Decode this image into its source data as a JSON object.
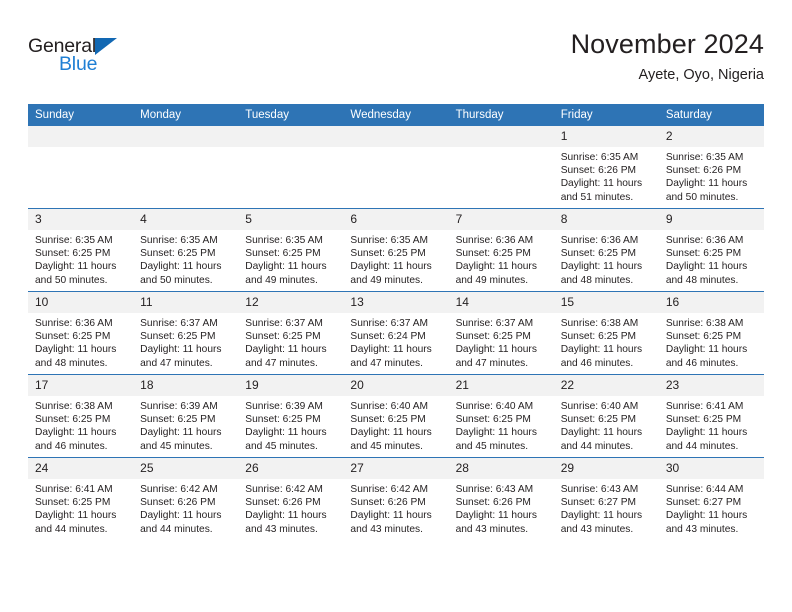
{
  "brand": {
    "name_part1": "General",
    "name_part2": "Blue",
    "logo_icon": "triangle-logo-icon",
    "colors": {
      "text": "#231f20",
      "blue": "#1f7fd4",
      "triangle": "#1268b3"
    }
  },
  "header": {
    "title": "November 2024",
    "subtitle": "Ayete, Oyo, Nigeria"
  },
  "theme": {
    "header_row_bg": "#2e74b5",
    "header_row_text": "#ffffff",
    "daynum_bg": "#f2f2f2",
    "cell_text": "#231f20",
    "row_divider": "#2e74b5"
  },
  "weekdays": [
    {
      "label": "Sunday"
    },
    {
      "label": "Monday"
    },
    {
      "label": "Tuesday"
    },
    {
      "label": "Wednesday"
    },
    {
      "label": "Thursday"
    },
    {
      "label": "Friday"
    },
    {
      "label": "Saturday"
    }
  ],
  "weeks": [
    [
      {
        "day": "",
        "empty": true,
        "sunrise": "",
        "sunset": "",
        "daylight": ""
      },
      {
        "day": "",
        "empty": true,
        "sunrise": "",
        "sunset": "",
        "daylight": ""
      },
      {
        "day": "",
        "empty": true,
        "sunrise": "",
        "sunset": "",
        "daylight": ""
      },
      {
        "day": "",
        "empty": true,
        "sunrise": "",
        "sunset": "",
        "daylight": ""
      },
      {
        "day": "",
        "empty": true,
        "sunrise": "",
        "sunset": "",
        "daylight": ""
      },
      {
        "day": "1",
        "empty": false,
        "sunrise": "Sunrise: 6:35 AM",
        "sunset": "Sunset: 6:26 PM",
        "daylight": "Daylight: 11 hours and 51 minutes."
      },
      {
        "day": "2",
        "empty": false,
        "sunrise": "Sunrise: 6:35 AM",
        "sunset": "Sunset: 6:26 PM",
        "daylight": "Daylight: 11 hours and 50 minutes."
      }
    ],
    [
      {
        "day": "3",
        "empty": false,
        "sunrise": "Sunrise: 6:35 AM",
        "sunset": "Sunset: 6:25 PM",
        "daylight": "Daylight: 11 hours and 50 minutes."
      },
      {
        "day": "4",
        "empty": false,
        "sunrise": "Sunrise: 6:35 AM",
        "sunset": "Sunset: 6:25 PM",
        "daylight": "Daylight: 11 hours and 50 minutes."
      },
      {
        "day": "5",
        "empty": false,
        "sunrise": "Sunrise: 6:35 AM",
        "sunset": "Sunset: 6:25 PM",
        "daylight": "Daylight: 11 hours and 49 minutes."
      },
      {
        "day": "6",
        "empty": false,
        "sunrise": "Sunrise: 6:35 AM",
        "sunset": "Sunset: 6:25 PM",
        "daylight": "Daylight: 11 hours and 49 minutes."
      },
      {
        "day": "7",
        "empty": false,
        "sunrise": "Sunrise: 6:36 AM",
        "sunset": "Sunset: 6:25 PM",
        "daylight": "Daylight: 11 hours and 49 minutes."
      },
      {
        "day": "8",
        "empty": false,
        "sunrise": "Sunrise: 6:36 AM",
        "sunset": "Sunset: 6:25 PM",
        "daylight": "Daylight: 11 hours and 48 minutes."
      },
      {
        "day": "9",
        "empty": false,
        "sunrise": "Sunrise: 6:36 AM",
        "sunset": "Sunset: 6:25 PM",
        "daylight": "Daylight: 11 hours and 48 minutes."
      }
    ],
    [
      {
        "day": "10",
        "empty": false,
        "sunrise": "Sunrise: 6:36 AM",
        "sunset": "Sunset: 6:25 PM",
        "daylight": "Daylight: 11 hours and 48 minutes."
      },
      {
        "day": "11",
        "empty": false,
        "sunrise": "Sunrise: 6:37 AM",
        "sunset": "Sunset: 6:25 PM",
        "daylight": "Daylight: 11 hours and 47 minutes."
      },
      {
        "day": "12",
        "empty": false,
        "sunrise": "Sunrise: 6:37 AM",
        "sunset": "Sunset: 6:25 PM",
        "daylight": "Daylight: 11 hours and 47 minutes."
      },
      {
        "day": "13",
        "empty": false,
        "sunrise": "Sunrise: 6:37 AM",
        "sunset": "Sunset: 6:24 PM",
        "daylight": "Daylight: 11 hours and 47 minutes."
      },
      {
        "day": "14",
        "empty": false,
        "sunrise": "Sunrise: 6:37 AM",
        "sunset": "Sunset: 6:25 PM",
        "daylight": "Daylight: 11 hours and 47 minutes."
      },
      {
        "day": "15",
        "empty": false,
        "sunrise": "Sunrise: 6:38 AM",
        "sunset": "Sunset: 6:25 PM",
        "daylight": "Daylight: 11 hours and 46 minutes."
      },
      {
        "day": "16",
        "empty": false,
        "sunrise": "Sunrise: 6:38 AM",
        "sunset": "Sunset: 6:25 PM",
        "daylight": "Daylight: 11 hours and 46 minutes."
      }
    ],
    [
      {
        "day": "17",
        "empty": false,
        "sunrise": "Sunrise: 6:38 AM",
        "sunset": "Sunset: 6:25 PM",
        "daylight": "Daylight: 11 hours and 46 minutes."
      },
      {
        "day": "18",
        "empty": false,
        "sunrise": "Sunrise: 6:39 AM",
        "sunset": "Sunset: 6:25 PM",
        "daylight": "Daylight: 11 hours and 45 minutes."
      },
      {
        "day": "19",
        "empty": false,
        "sunrise": "Sunrise: 6:39 AM",
        "sunset": "Sunset: 6:25 PM",
        "daylight": "Daylight: 11 hours and 45 minutes."
      },
      {
        "day": "20",
        "empty": false,
        "sunrise": "Sunrise: 6:40 AM",
        "sunset": "Sunset: 6:25 PM",
        "daylight": "Daylight: 11 hours and 45 minutes."
      },
      {
        "day": "21",
        "empty": false,
        "sunrise": "Sunrise: 6:40 AM",
        "sunset": "Sunset: 6:25 PM",
        "daylight": "Daylight: 11 hours and 45 minutes."
      },
      {
        "day": "22",
        "empty": false,
        "sunrise": "Sunrise: 6:40 AM",
        "sunset": "Sunset: 6:25 PM",
        "daylight": "Daylight: 11 hours and 44 minutes."
      },
      {
        "day": "23",
        "empty": false,
        "sunrise": "Sunrise: 6:41 AM",
        "sunset": "Sunset: 6:25 PM",
        "daylight": "Daylight: 11 hours and 44 minutes."
      }
    ],
    [
      {
        "day": "24",
        "empty": false,
        "sunrise": "Sunrise: 6:41 AM",
        "sunset": "Sunset: 6:25 PM",
        "daylight": "Daylight: 11 hours and 44 minutes."
      },
      {
        "day": "25",
        "empty": false,
        "sunrise": "Sunrise: 6:42 AM",
        "sunset": "Sunset: 6:26 PM",
        "daylight": "Daylight: 11 hours and 44 minutes."
      },
      {
        "day": "26",
        "empty": false,
        "sunrise": "Sunrise: 6:42 AM",
        "sunset": "Sunset: 6:26 PM",
        "daylight": "Daylight: 11 hours and 43 minutes."
      },
      {
        "day": "27",
        "empty": false,
        "sunrise": "Sunrise: 6:42 AM",
        "sunset": "Sunset: 6:26 PM",
        "daylight": "Daylight: 11 hours and 43 minutes."
      },
      {
        "day": "28",
        "empty": false,
        "sunrise": "Sunrise: 6:43 AM",
        "sunset": "Sunset: 6:26 PM",
        "daylight": "Daylight: 11 hours and 43 minutes."
      },
      {
        "day": "29",
        "empty": false,
        "sunrise": "Sunrise: 6:43 AM",
        "sunset": "Sunset: 6:27 PM",
        "daylight": "Daylight: 11 hours and 43 minutes."
      },
      {
        "day": "30",
        "empty": false,
        "sunrise": "Sunrise: 6:44 AM",
        "sunset": "Sunset: 6:27 PM",
        "daylight": "Daylight: 11 hours and 43 minutes."
      }
    ]
  ]
}
